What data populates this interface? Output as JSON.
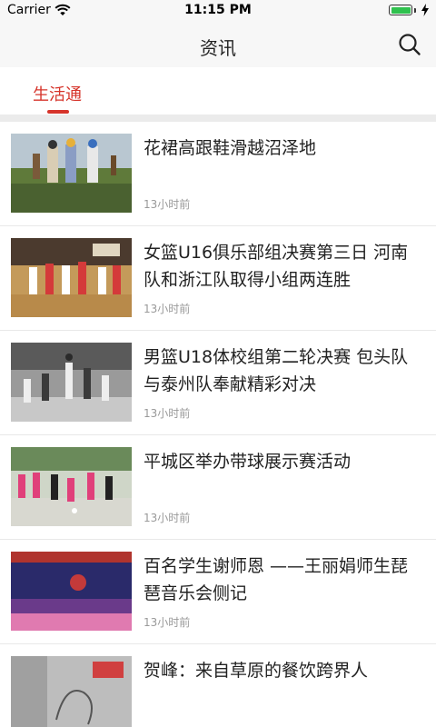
{
  "status": {
    "carrier": "Carrier",
    "time": "11:15 PM",
    "battery_level": 1.0
  },
  "nav": {
    "title": "资讯",
    "search_icon": "search-icon"
  },
  "tabs": [
    {
      "label": "生活通",
      "active": true
    }
  ],
  "colors": {
    "accent": "#d6342b",
    "battery": "#2fc14e"
  },
  "news": [
    {
      "title": "花裙高跟鞋滑越沼泽地",
      "time": "13小时前"
    },
    {
      "title": "女篮U16俱乐部组决赛第三日  河南队和浙江队取得小组两连胜",
      "time": "13小时前"
    },
    {
      "title": "男篮U18体校组第二轮决赛  包头队与泰州队奉献精彩对决",
      "time": "13小时前"
    },
    {
      "title": "平城区举办带球展示赛活动",
      "time": "13小时前"
    },
    {
      "title": "百名学生谢师恩 ——王丽娟师生琵琶音乐会侧记",
      "time": "13小时前"
    },
    {
      "title": "贺峰：来自草原的餐饮跨界人",
      "time": ""
    }
  ]
}
